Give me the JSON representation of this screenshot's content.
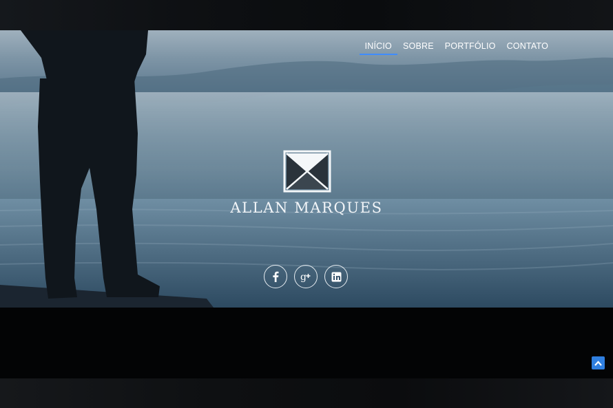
{
  "nav": {
    "items": [
      {
        "label": "INÍCIO",
        "active": true
      },
      {
        "label": "SOBRE",
        "active": false
      },
      {
        "label": "PORTFÓLIO",
        "active": false
      },
      {
        "label": "CONTATO",
        "active": false
      }
    ]
  },
  "hero": {
    "brand": "ALLAN MARQUES",
    "logo_icon": "bowtie-logo-icon"
  },
  "social": [
    {
      "icon": "facebook-icon"
    },
    {
      "icon": "google-plus-icon"
    },
    {
      "icon": "linkedin-icon"
    }
  ],
  "back_to_top": {
    "icon": "chevron-up-icon"
  },
  "colors": {
    "accent": "#3f8cff",
    "back_to_top": "#2f7fe0"
  }
}
